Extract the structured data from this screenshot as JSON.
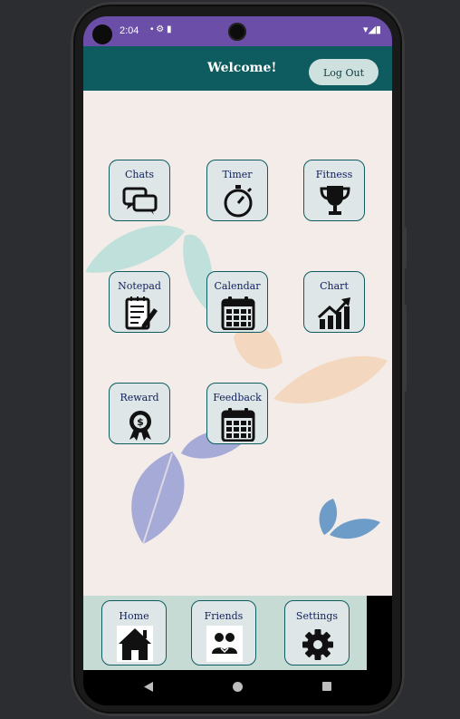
{
  "status_bar": {
    "time": "2:04",
    "icons_left": "• ⚙ ▮",
    "icons_right": "▾◢▮"
  },
  "app_bar": {
    "title": "Welcome!",
    "logout_label": "Log Out"
  },
  "tiles": [
    {
      "label": "Chats",
      "icon": "chat-bubbles-icon"
    },
    {
      "label": "Timer",
      "icon": "stopwatch-icon"
    },
    {
      "label": "Fitness",
      "icon": "trophy-icon"
    },
    {
      "label": "Notepad",
      "icon": "notepad-icon"
    },
    {
      "label": "Calendar",
      "icon": "calendar-icon"
    },
    {
      "label": "Chart",
      "icon": "growth-chart-icon"
    },
    {
      "label": "Reward",
      "icon": "reward-badge-icon"
    },
    {
      "label": "Feedback",
      "icon": "calendar-icon"
    }
  ],
  "bottom_nav": [
    {
      "label": "Home",
      "icon": "house-icon"
    },
    {
      "label": "Friends",
      "icon": "friends-icon"
    },
    {
      "label": "Settings",
      "icon": "gear-icon"
    }
  ],
  "colors": {
    "status_bar": "#6a4ea8",
    "app_bar": "#0e5c60",
    "background": "#f3ece8",
    "tile": "#dfe6e8",
    "bottom_nav": "#c7dbd5",
    "label_text": "#0e1f5a"
  }
}
